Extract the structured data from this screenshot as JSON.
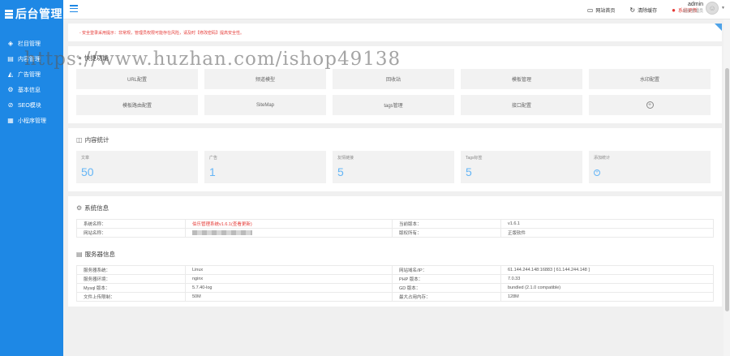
{
  "app": {
    "logo_text": "后台管理"
  },
  "sidebar": {
    "items": [
      {
        "label": "栏目管理",
        "icon": "layers-icon"
      },
      {
        "label": "内容管理",
        "icon": "document-icon"
      },
      {
        "label": "广告管理",
        "icon": "megaphone-icon"
      },
      {
        "label": "基本信息",
        "icon": "gear-icon"
      },
      {
        "label": "SEO模块",
        "icon": "seo-icon"
      },
      {
        "label": "小程序管理",
        "icon": "grid-icon"
      }
    ]
  },
  "topbar": {
    "site_home": "网站首页",
    "clear_cache": "清除缓存",
    "system_update": "系统更新",
    "user_name": "admin",
    "user_role": "超级管理员"
  },
  "notice": {
    "text": "- 安全登录采用提示：非常规，管理员权限可能存在风险，请及时【修改密码】提高安全性。"
  },
  "quick": {
    "title": "快捷功能",
    "items": [
      "URL配置",
      "频道模型",
      "回收站",
      "模板管理",
      "水印配置",
      "模板路由配置",
      "SiteMap",
      "tags管理",
      "接口配置"
    ]
  },
  "stats": {
    "title": "内容统计",
    "items": [
      {
        "label": "文章",
        "value": "50"
      },
      {
        "label": "广告",
        "value": "1"
      },
      {
        "label": "友情链接",
        "value": "5"
      },
      {
        "label": "Tags标签",
        "value": "5"
      },
      {
        "label": "添加统计",
        "value": ""
      }
    ]
  },
  "system": {
    "title": "系统信息",
    "rows": [
      [
        "系统名称：",
        "伯乐管理系统v1.6.1(查看更新)",
        "当前版本：",
        "v1.6.1"
      ],
      [
        "网站名称：",
        "",
        "版权所有：",
        "正版软件"
      ]
    ]
  },
  "server": {
    "title": "服务器信息",
    "rows": [
      [
        "服务器系统：",
        "Linux",
        "网站域名/IP：",
        "61.144.244.148:16883 [ 61.144.244.148 ]"
      ],
      [
        "服务器环境：",
        "nginx",
        "PHP 版本：",
        "7.0.33"
      ],
      [
        "Mysql 版本：",
        "5.7.40-log",
        "GD 版本：",
        "bundled (2.1.0 compatible)"
      ],
      [
        "文件上传限制：",
        "50M",
        "最大占用内存：",
        "128M"
      ]
    ]
  },
  "watermark": {
    "text": "https://www.huzhan.com/ishop49138"
  },
  "colors": {
    "primary": "#1e88e5",
    "danger": "#e53935",
    "stat_value": "#64b5f6"
  }
}
